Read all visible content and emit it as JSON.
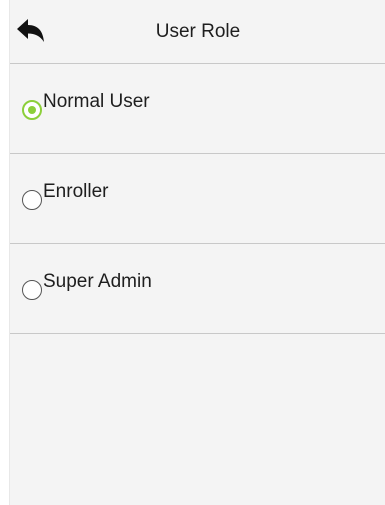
{
  "header": {
    "title": "User Role",
    "back_icon": "back-arrow-icon"
  },
  "options": [
    {
      "label": "Normal User",
      "selected": true
    },
    {
      "label": "Enroller",
      "selected": false
    },
    {
      "label": "Super Admin",
      "selected": false
    }
  ],
  "colors": {
    "background": "#f4f4f4",
    "divider": "#c8c8c8",
    "accent": "#8ccf3a",
    "text": "#1e1e1e"
  }
}
